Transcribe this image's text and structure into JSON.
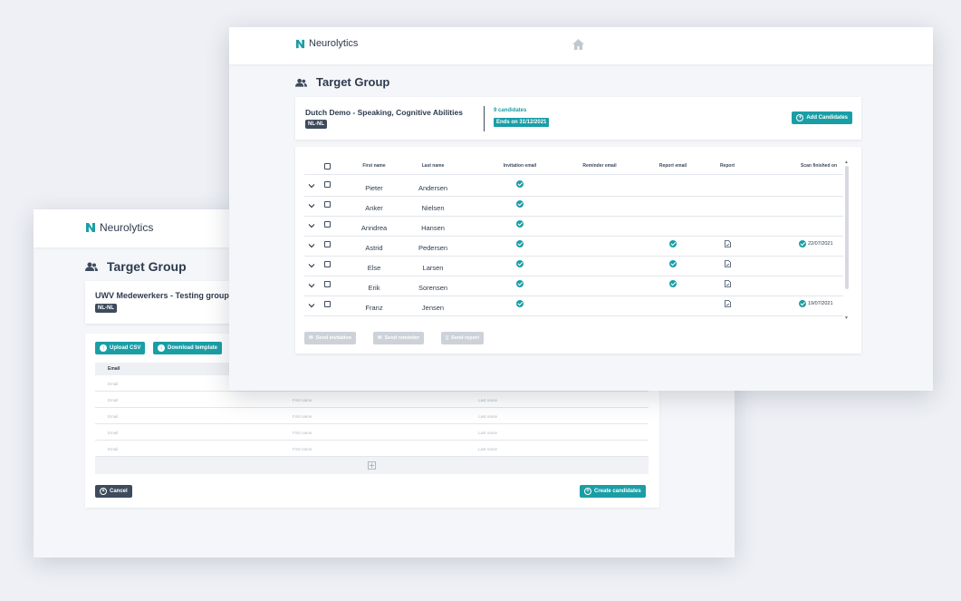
{
  "brand": {
    "name": "Neurolytics",
    "accent": "#1a9ea6",
    "dark": "#3d4b5c"
  },
  "back_window": {
    "page_title": "Target Group",
    "group_name": "UWV Medewerkers - Testing group",
    "language": "NL-NL",
    "upload_csv_label": "Upload CSV",
    "download_template_label": "Download template",
    "email_column_header": "Email",
    "rows": [
      {
        "email": "Email",
        "first": "",
        "last": ""
      },
      {
        "email": "Email",
        "first": "First name",
        "last": "Last name"
      },
      {
        "email": "Email",
        "first": "First name",
        "last": "Last name"
      },
      {
        "email": "Email",
        "first": "First name",
        "last": "Last name"
      },
      {
        "email": "Email",
        "first": "First name",
        "last": "Last name"
      }
    ],
    "cancel_label": "Cancel",
    "create_label": "Create candidates"
  },
  "front_window": {
    "page_title": "Target Group",
    "demo_name": "Dutch Demo - Speaking, Cognitive Abilities",
    "language": "NL-NL",
    "candidate_count": "9 candidates",
    "ends_on": "Ends on 31/12/2021",
    "add_candidates_label": "Add Candidates",
    "columns": {
      "first_name": "First name",
      "last_name": "Last name",
      "invitation_email": "Invitation email",
      "reminder_email": "Reminder email",
      "report_email": "Report email",
      "report": "Report",
      "scan_finished": "Scan finished on"
    },
    "candidates": [
      {
        "first": "Pieter",
        "last": "Andersen",
        "invitation": true,
        "report_email": false,
        "report": false,
        "scan_date": ""
      },
      {
        "first": "Anker",
        "last": "Nielsen",
        "invitation": true,
        "report_email": false,
        "report": false,
        "scan_date": ""
      },
      {
        "first": "Anndrea",
        "last": "Hansen",
        "invitation": true,
        "report_email": false,
        "report": false,
        "scan_date": ""
      },
      {
        "first": "Astrid",
        "last": "Pedersen",
        "invitation": true,
        "report_email": true,
        "report": true,
        "scan_date": "22/07/2021"
      },
      {
        "first": "Else",
        "last": "Larsen",
        "invitation": true,
        "report_email": true,
        "report": true,
        "scan_date": ""
      },
      {
        "first": "Erik",
        "last": "Sorensen",
        "invitation": true,
        "report_email": true,
        "report": true,
        "scan_date": ""
      },
      {
        "first": "Franz",
        "last": "Jensen",
        "invitation": true,
        "report_email": false,
        "report": true,
        "scan_date": "19/07/2021"
      }
    ],
    "send_invitation_label": "Send invitation",
    "send_reminder_label": "Send reminder",
    "send_report_label": "Send report"
  }
}
